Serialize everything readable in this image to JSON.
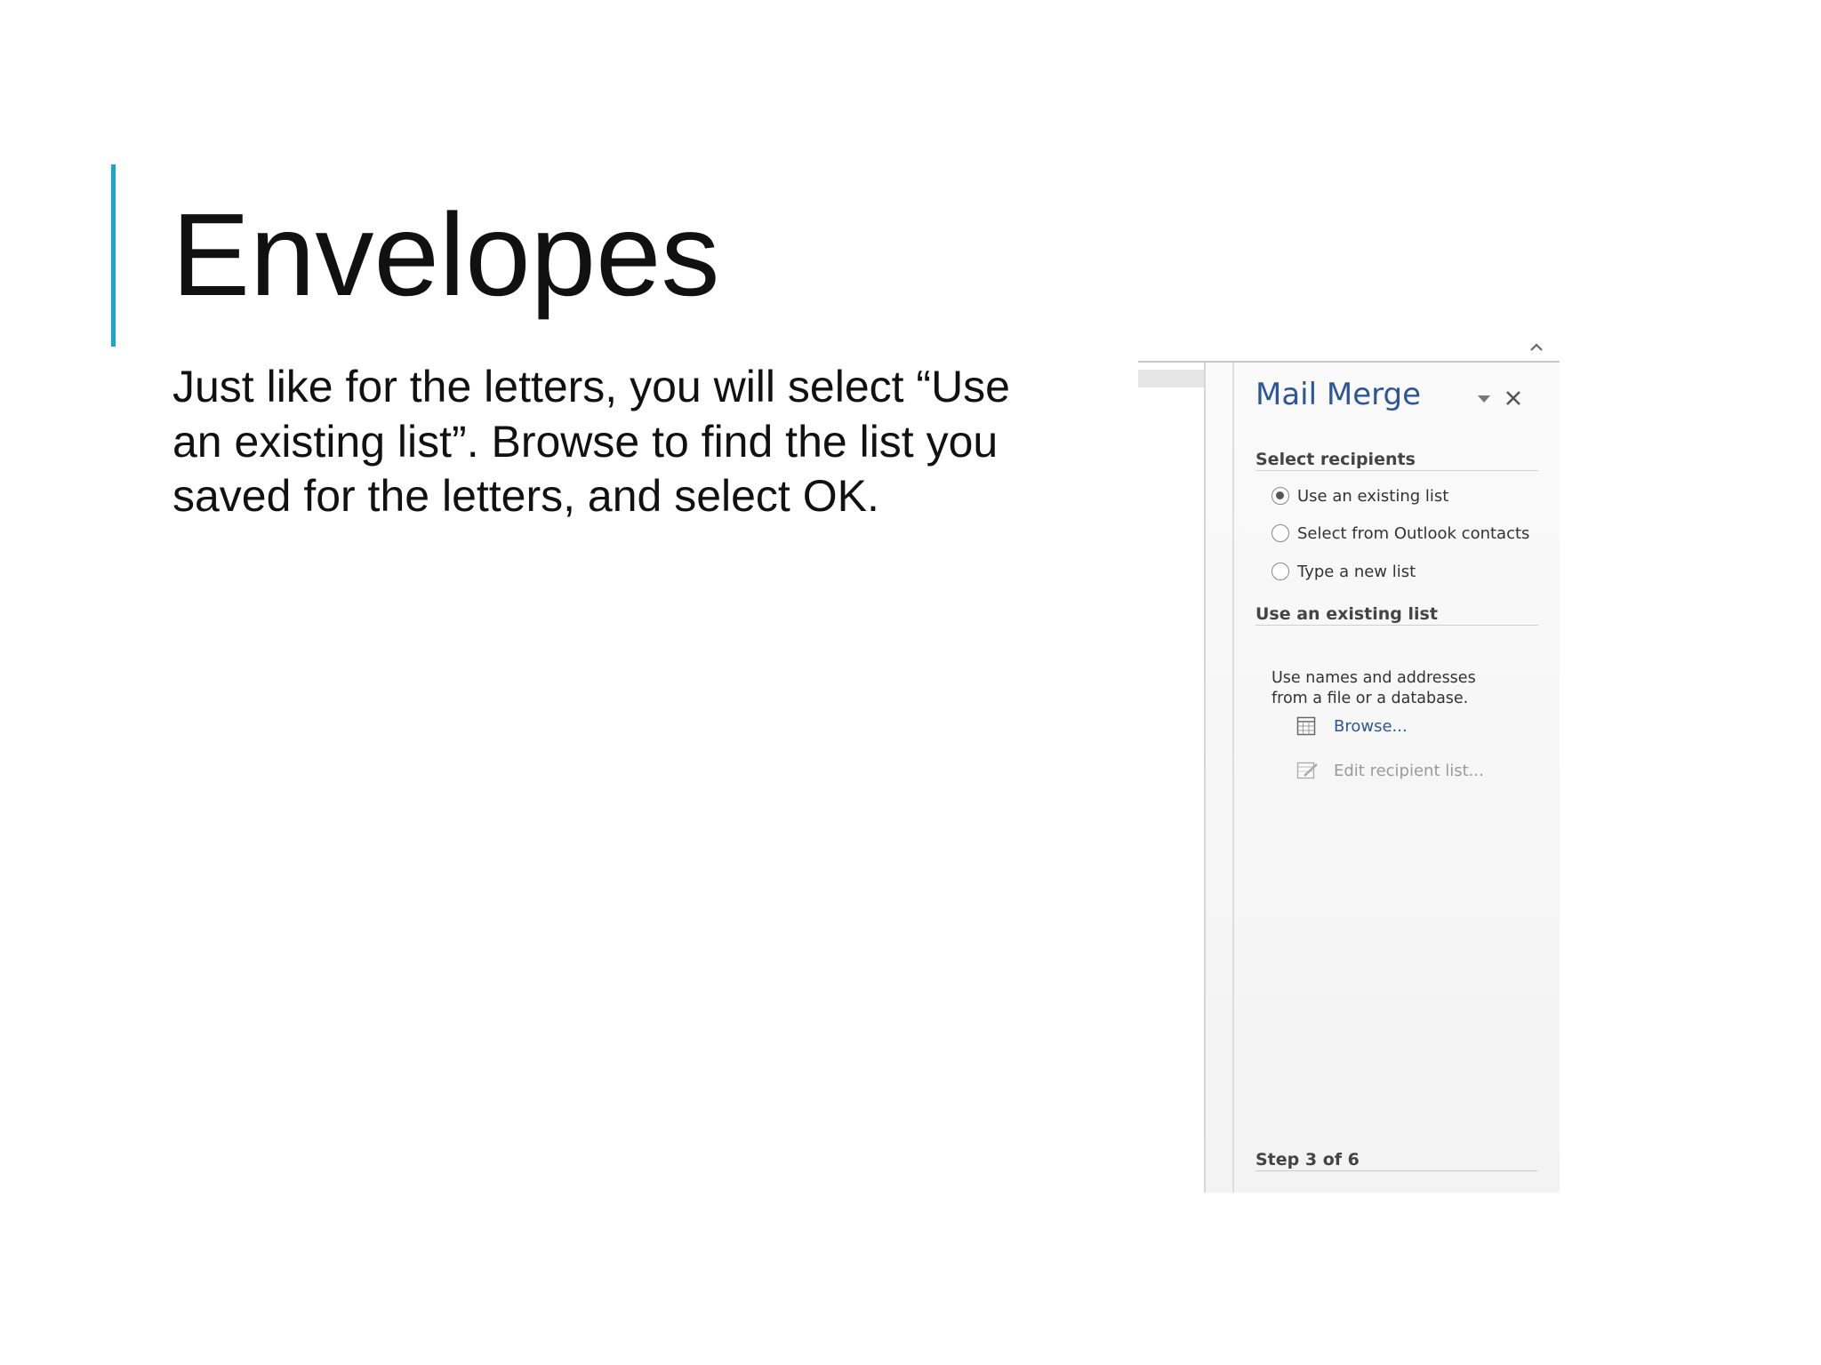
{
  "slide": {
    "title": "Envelopes",
    "body": "Just like for the letters, you will select “Use an existing list”. Browse to find the list you saved for the letters, and select OK.",
    "accent_color": "#1aa3d6"
  },
  "mail_merge_pane": {
    "title": "Mail Merge",
    "title_color": "#2b579a",
    "dropdown_icon": "caret-down-icon",
    "close_icon": "close-icon",
    "collapse_icon": "chevron-up-icon",
    "select_recipients": {
      "heading": "Select recipients",
      "options": [
        {
          "label": "Use an existing list",
          "checked": true
        },
        {
          "label": "Select from Outlook contacts",
          "checked": false
        },
        {
          "label": "Type a new list",
          "checked": false
        }
      ]
    },
    "use_existing_list": {
      "heading": "Use an existing list",
      "description_line1": "Use names and addresses",
      "description_line2": "from a file or a database.",
      "browse_label": "Browse...",
      "browse_icon": "table-icon",
      "edit_label": "Edit recipient list...",
      "edit_icon": "edit-list-icon"
    },
    "step": "Step 3 of 6"
  }
}
